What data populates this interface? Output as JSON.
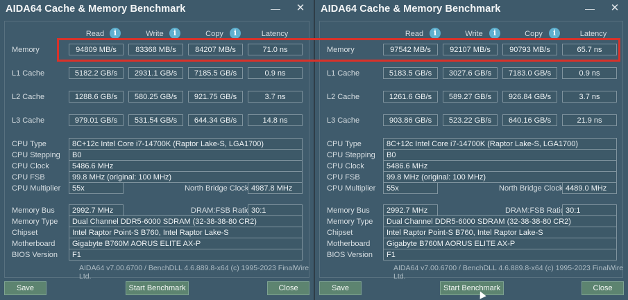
{
  "left": {
    "title": "AIDA64 Cache & Memory Benchmark",
    "columns": [
      "Read",
      "Write",
      "Copy",
      "Latency"
    ],
    "rows": [
      {
        "label": "Memory",
        "values": [
          "94809 MB/s",
          "83368 MB/s",
          "84207 MB/s",
          "71.0 ns"
        ]
      },
      {
        "label": "L1 Cache",
        "values": [
          "5182.2 GB/s",
          "2931.1 GB/s",
          "7185.5 GB/s",
          "0.9 ns"
        ]
      },
      {
        "label": "L2 Cache",
        "values": [
          "1288.6 GB/s",
          "580.25 GB/s",
          "921.75 GB/s",
          "3.7 ns"
        ]
      },
      {
        "label": "L3 Cache",
        "values": [
          "979.01 GB/s",
          "531.54 GB/s",
          "644.34 GB/s",
          "14.8 ns"
        ]
      }
    ],
    "cpu": {
      "type_label": "CPU Type",
      "type_value": "8C+12c Intel Core i7-14700K  (Raptor Lake-S, LGA1700)",
      "stepping_label": "CPU Stepping",
      "stepping_value": "B0",
      "clock_label": "CPU Clock",
      "clock_value": "5486.6 MHz",
      "fsb_label": "CPU FSB",
      "fsb_value": "99.8 MHz  (original: 100 MHz)",
      "mult_label": "CPU Multiplier",
      "mult_value": "55x",
      "nb_label": "North Bridge Clock",
      "nb_value": "4987.8 MHz"
    },
    "mem": {
      "bus_label": "Memory Bus",
      "bus_value": "2992.7 MHz",
      "ratio_label": "DRAM:FSB Ratio",
      "ratio_value": "30:1",
      "type_label": "Memory Type",
      "type_value": "Dual Channel DDR5-6000 SDRAM  (32-38-38-80 CR2)",
      "chipset_label": "Chipset",
      "chipset_value": "Intel Raptor Point-S B760, Intel Raptor Lake-S",
      "mb_label": "Motherboard",
      "mb_value": "Gigabyte B760M AORUS ELITE AX-P",
      "bios_label": "BIOS Version",
      "bios_value": "F1"
    },
    "footer": "AIDA64 v7.00.6700 / BenchDLL 4.6.889.8-x64  (c) 1995-2023 FinalWire Ltd.",
    "buttons": {
      "save": "Save",
      "start": "Start Benchmark",
      "close": "Close"
    }
  },
  "right": {
    "title": "AIDA64 Cache & Memory Benchmark",
    "columns": [
      "Read",
      "Write",
      "Copy",
      "Latency"
    ],
    "rows": [
      {
        "label": "Memory",
        "values": [
          "97542 MB/s",
          "92107 MB/s",
          "90793 MB/s",
          "65.7 ns"
        ]
      },
      {
        "label": "L1 Cache",
        "values": [
          "5183.5 GB/s",
          "3027.6 GB/s",
          "7183.0 GB/s",
          "0.9 ns"
        ]
      },
      {
        "label": "L2 Cache",
        "values": [
          "1261.6 GB/s",
          "589.27 GB/s",
          "926.84 GB/s",
          "3.7 ns"
        ]
      },
      {
        "label": "L3 Cache",
        "values": [
          "903.86 GB/s",
          "523.22 GB/s",
          "640.16 GB/s",
          "21.9 ns"
        ]
      }
    ],
    "cpu": {
      "type_label": "CPU Type",
      "type_value": "8C+12c Intel Core i7-14700K  (Raptor Lake-S, LGA1700)",
      "stepping_label": "CPU Stepping",
      "stepping_value": "B0",
      "clock_label": "CPU Clock",
      "clock_value": "5486.6 MHz",
      "fsb_label": "CPU FSB",
      "fsb_value": "99.8 MHz  (original: 100 MHz)",
      "mult_label": "CPU Multiplier",
      "mult_value": "55x",
      "nb_label": "North Bridge Clock",
      "nb_value": "4489.0 MHz"
    },
    "mem": {
      "bus_label": "Memory Bus",
      "bus_value": "2992.7 MHz",
      "ratio_label": "DRAM:FSB Ratio",
      "ratio_value": "30:1",
      "type_label": "Memory Type",
      "type_value": "Dual Channel DDR5-6000 SDRAM  (32-38-38-80 CR2)",
      "chipset_label": "Chipset",
      "chipset_value": "Intel Raptor Point-S B760, Intel Raptor Lake-S",
      "mb_label": "Motherboard",
      "mb_value": "Gigabyte B760M AORUS ELITE AX-P",
      "bios_label": "BIOS Version",
      "bios_value": "F1"
    },
    "footer": "AIDA64 v7.00.6700 / BenchDLL 4.6.889.8-x64  (c) 1995-2023 FinalWire Ltd.",
    "buttons": {
      "save": "Save",
      "start": "Start Benchmark",
      "close": "Close"
    }
  },
  "window_controls": {
    "minimize": "—",
    "close": "✕"
  },
  "icons": {
    "info": "i"
  },
  "colors": {
    "window_bg": "#3e5a6b",
    "button_bg": "#5d8470",
    "highlight": "#d8322a"
  }
}
